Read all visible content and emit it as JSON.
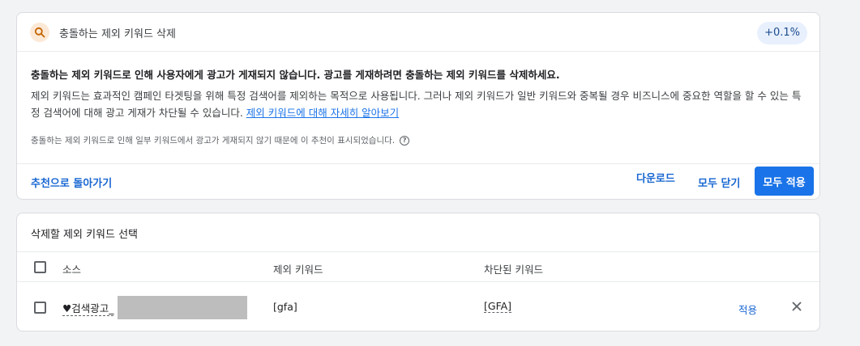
{
  "recommendation": {
    "title": "충돌하는 제외 키워드 삭제",
    "badge": "+0.1%",
    "headline": "충돌하는 제외 키워드로 인해 사용자에게 광고가 게재되지 않습니다. 광고를 게재하려면 충돌하는 제외 키워드를 삭제하세요.",
    "description": "제외 키워드는 효과적인 캠페인 타겟팅을 위해 특정 검색어를 제외하는 목적으로 사용됩니다. 그러나 제외 키워드가 일반 키워드와 중복될 경우 비즈니스에 중요한 역할을 할 수 있는 특정 검색어에 대해 광고 게재가 차단될 수 있습니다.",
    "learn_more": "제외 키워드에 대해 자세히 알아보기",
    "note": "충돌하는 제외 키워드로 인해 일부 키워드에서 광고가 게재되지 않기 때문에 이 추천이 표시되었습니다.",
    "help_icon": "question-circle-icon",
    "icon": "search-icon",
    "accent": "#1a73e8",
    "back_label": "추천으로 돌아가기",
    "download_label": "다운로드",
    "close_all_label": "모두 닫기",
    "apply_all_label": "모두 적용"
  },
  "selection": {
    "title": "삭제할 제외 키워드 선택",
    "columns": {
      "source": "소스",
      "negative_keyword": "제외 키워드",
      "blocked_keyword": "차단된 키워드"
    },
    "rows": [
      {
        "source": "♥검색광고_",
        "negative_keyword": "[gfa]",
        "blocked_keyword": "[GFA]",
        "apply_label": "적용"
      }
    ]
  }
}
